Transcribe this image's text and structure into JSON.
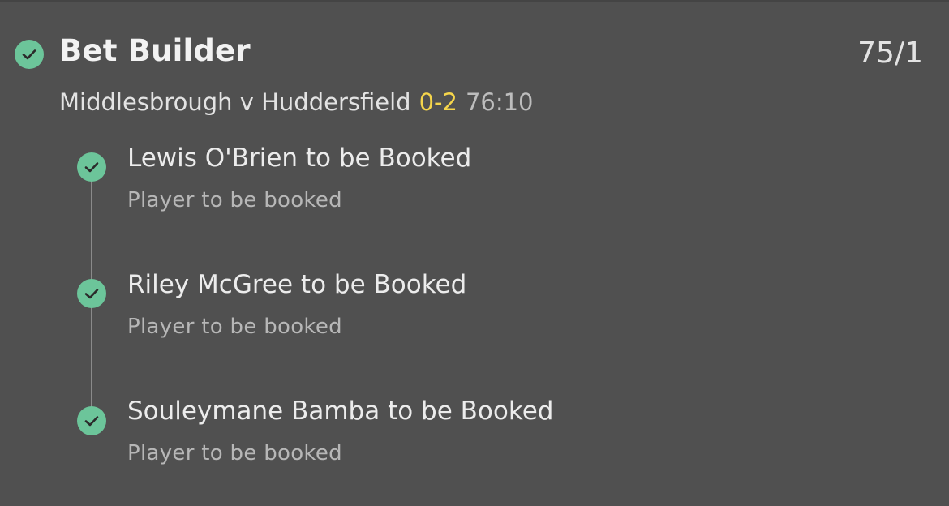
{
  "header": {
    "title": "Bet Builder",
    "odds": "75/1",
    "status_icon": "check-circle-icon"
  },
  "match": {
    "teams": "Middlesbrough v Huddersfield",
    "score": "0-2",
    "clock": "76:10"
  },
  "selections": [
    {
      "title": "Lewis O'Brien to be Booked",
      "subtitle": "Player to be booked",
      "status_icon": "check-circle-icon"
    },
    {
      "title": "Riley McGree to be Booked",
      "subtitle": "Player to be booked",
      "status_icon": "check-circle-icon"
    },
    {
      "title": "Souleymane Bamba to be Booked",
      "subtitle": "Player to be booked",
      "status_icon": "check-circle-icon"
    }
  ],
  "colors": {
    "background": "#505050",
    "check": "#6cc59a",
    "score": "#f5d54b",
    "text_primary": "#f2f2f2",
    "text_secondary": "#b7b7b7"
  }
}
